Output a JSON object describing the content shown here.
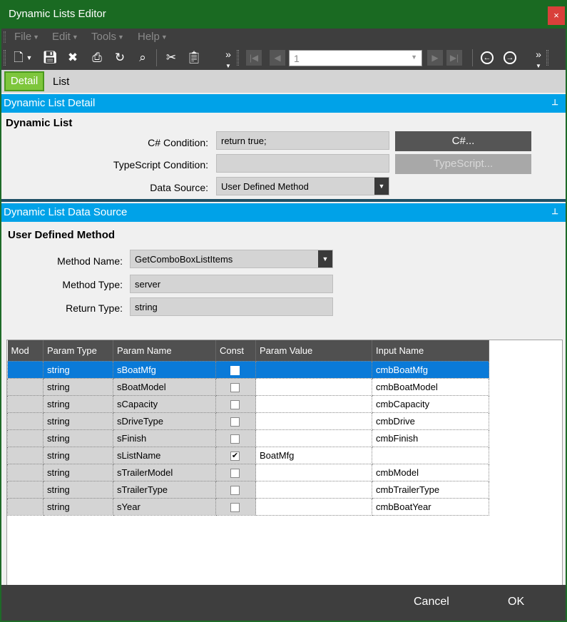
{
  "window": {
    "title": "Dynamic Lists Editor",
    "close_glyph": "×"
  },
  "menu": [
    {
      "label": "File"
    },
    {
      "label": "Edit"
    },
    {
      "label": "Tools"
    },
    {
      "label": "Help"
    }
  ],
  "toolbar": {
    "record_number": "1",
    "overflow_glyph": "»"
  },
  "tabs": {
    "detail": "Detail",
    "list": "List"
  },
  "detail_section": {
    "header": "Dynamic List Detail",
    "subtitle": "Dynamic List",
    "csharp_label": "C# Condition:",
    "csharp_value": "return true;",
    "csharp_button": "C#...",
    "ts_label": "TypeScript Condition:",
    "ts_value": "",
    "ts_button": "TypeScript...",
    "ds_label": "Data Source:",
    "ds_value": "User Defined Method"
  },
  "datasource_section": {
    "header": "Dynamic List Data Source",
    "subtitle": "User Defined Method",
    "method_name_label": "Method Name:",
    "method_name_value": "GetComboBoxListItems",
    "method_type_label": "Method Type:",
    "method_type_value": "server",
    "return_type_label": "Return Type:",
    "return_type_value": "string"
  },
  "grid": {
    "columns": [
      "Mod",
      "Param Type",
      "Param Name",
      "Const",
      "Param Value",
      "Input Name"
    ],
    "rows": [
      {
        "mod": "",
        "param_type": "string",
        "param_name": "sBoatMfg",
        "const": false,
        "param_value": "",
        "input_name": "cmbBoatMfg",
        "selected": true
      },
      {
        "mod": "",
        "param_type": "string",
        "param_name": "sBoatModel",
        "const": false,
        "param_value": "",
        "input_name": "cmbBoatModel",
        "selected": false
      },
      {
        "mod": "",
        "param_type": "string",
        "param_name": "sCapacity",
        "const": false,
        "param_value": "",
        "input_name": "cmbCapacity",
        "selected": false
      },
      {
        "mod": "",
        "param_type": "string",
        "param_name": "sDriveType",
        "const": false,
        "param_value": "",
        "input_name": "cmbDrive",
        "selected": false
      },
      {
        "mod": "",
        "param_type": "string",
        "param_name": "sFinish",
        "const": false,
        "param_value": "",
        "input_name": "cmbFinish",
        "selected": false
      },
      {
        "mod": "",
        "param_type": "string",
        "param_name": "sListName",
        "const": true,
        "param_value": "BoatMfg",
        "input_name": "",
        "selected": false
      },
      {
        "mod": "",
        "param_type": "string",
        "param_name": "sTrailerModel",
        "const": false,
        "param_value": "",
        "input_name": "cmbModel",
        "selected": false
      },
      {
        "mod": "",
        "param_type": "string",
        "param_name": "sTrailerType",
        "const": false,
        "param_value": "",
        "input_name": "cmbTrailerType",
        "selected": false
      },
      {
        "mod": "",
        "param_type": "string",
        "param_name": "sYear",
        "const": false,
        "param_value": "",
        "input_name": "cmbBoatYear",
        "selected": false
      }
    ]
  },
  "footer": {
    "cancel": "Cancel",
    "ok": "OK"
  },
  "colors": {
    "title_bar": "#1a6a22",
    "section_header": "#00a2e8",
    "selected_row": "#0a7ad8",
    "tab_active": "#7ec63c"
  }
}
